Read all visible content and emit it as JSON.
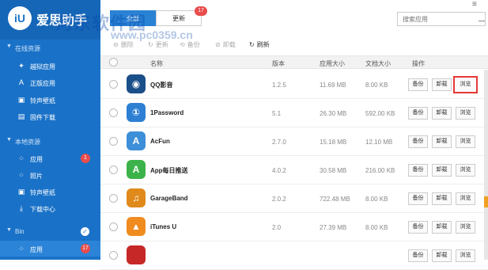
{
  "app": {
    "logo_text": "爱思助手",
    "logo_mark": "iU"
  },
  "watermark": {
    "line1": "河东软件园",
    "line2": "www.pc0359.cn"
  },
  "sidebar": {
    "online_section": "在线资源",
    "online_items": [
      {
        "label": "越狱应用",
        "icon": "jailbreak-icon"
      },
      {
        "label": "正版应用",
        "icon": "app-store-icon"
      },
      {
        "label": "铃声壁纸",
        "icon": "wallpaper-icon"
      },
      {
        "label": "固件下载",
        "icon": "firmware-icon"
      }
    ],
    "local_section": "本地资源",
    "local_items": [
      {
        "label": "应用",
        "icon": "apps-icon",
        "badge": "1"
      },
      {
        "label": "照片",
        "icon": "photos-icon"
      },
      {
        "label": "铃声壁纸",
        "icon": "wallpaper-icon"
      },
      {
        "label": "下载中心",
        "icon": "download-icon"
      }
    ],
    "device_section": "Bin",
    "device_items": [
      {
        "label": "应用",
        "icon": "apps-icon",
        "badge": "17"
      }
    ]
  },
  "tabs": [
    {
      "label": "全部",
      "selected": true
    },
    {
      "label": "更新",
      "badge": "17"
    }
  ],
  "search": {
    "placeholder": "搜索应用"
  },
  "toolbar": {
    "delete": "删除",
    "update": "更新",
    "backup": "备份",
    "uninstall": "卸载",
    "refresh": "刷新"
  },
  "table": {
    "headers": {
      "name": "名称",
      "version": "版本",
      "app_size": "应用大小",
      "doc_size": "文档大小",
      "actions": "操作"
    },
    "rows": [
      {
        "name": "QQ影音",
        "version": "1.2.5",
        "app_size": "11.69 MB",
        "doc_size": "8.00 KB",
        "icon_color": "#1b4f8a",
        "glyph": "◉"
      },
      {
        "name": "1Password",
        "version": "5.1",
        "app_size": "26.30 MB",
        "doc_size": "592.00 KB",
        "icon_color": "#2d7fd3",
        "glyph": "①"
      },
      {
        "name": "AcFun",
        "version": "2.7.0",
        "app_size": "15.18 MB",
        "doc_size": "12.10 MB",
        "icon_color": "#3c8fd8",
        "glyph": "A"
      },
      {
        "name": "App每日推送",
        "version": "4.0.2",
        "app_size": "30.58 MB",
        "doc_size": "216.00 KB",
        "icon_color": "#3cb34a",
        "glyph": "A"
      },
      {
        "name": "GarageBand",
        "version": "2.0.2",
        "app_size": "722.48 MB",
        "doc_size": "8.00 KB",
        "icon_color": "#e08a1c",
        "glyph": "♫"
      },
      {
        "name": "iTunes U",
        "version": "2.0",
        "app_size": "27.39 MB",
        "doc_size": "8.00 KB",
        "icon_color": "#f08b20",
        "glyph": "▲"
      },
      {
        "name": "",
        "version": "",
        "app_size": "",
        "doc_size": "",
        "icon_color": "#c62828",
        "glyph": ""
      }
    ],
    "btn_backup": "备份",
    "btn_uninstall": "卸载",
    "btn_browse": "浏览"
  }
}
